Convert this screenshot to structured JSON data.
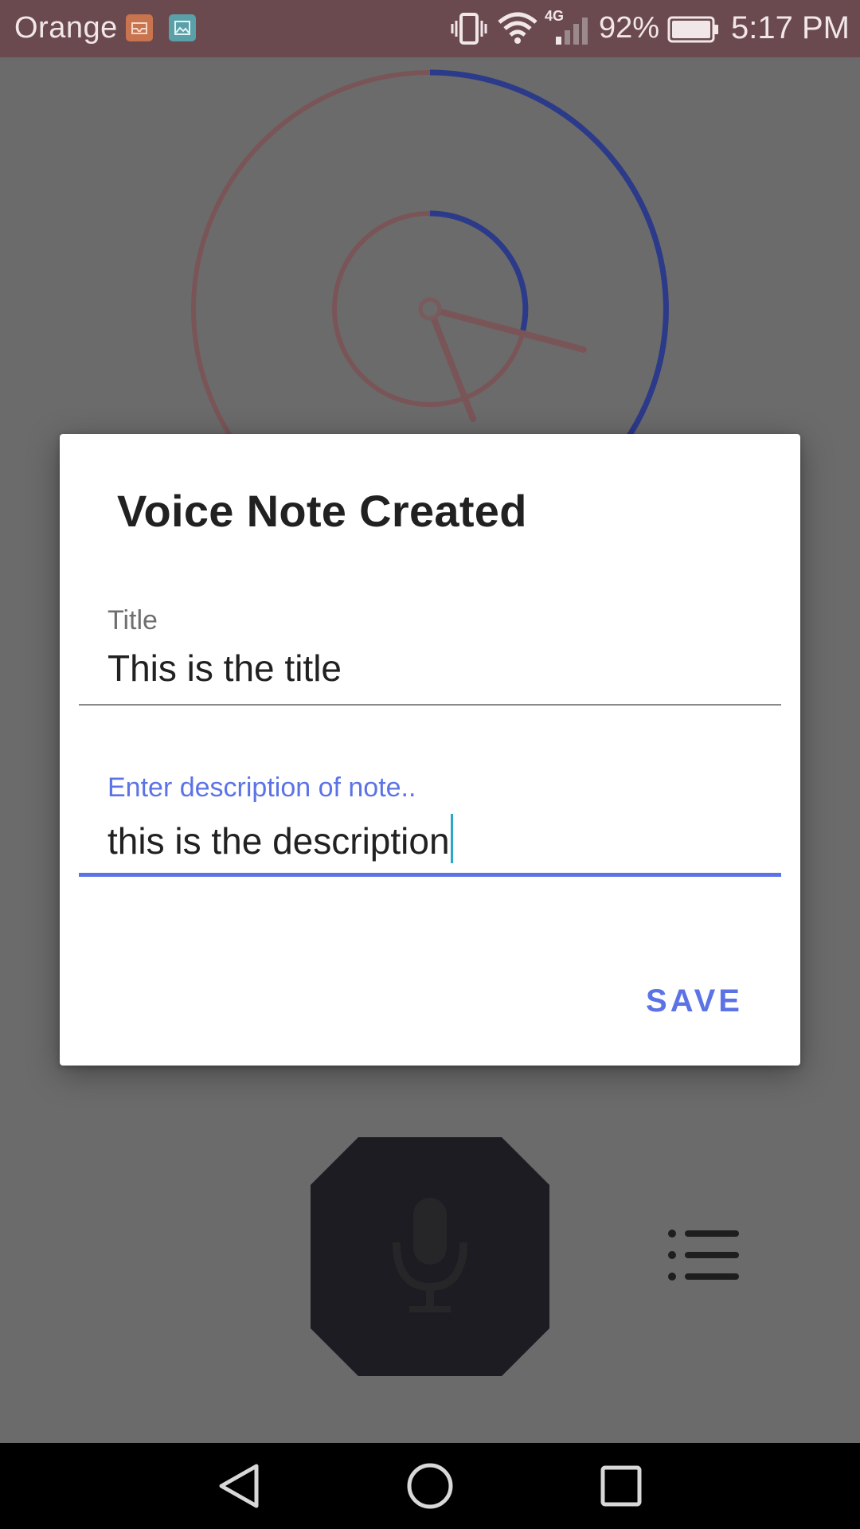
{
  "status_bar": {
    "carrier": "Orange",
    "battery_percent": "92%",
    "time": "5:17 PM",
    "network_type": "4G",
    "icons": [
      "inbox-notification-icon",
      "gallery-notification-icon",
      "vibrate-icon",
      "wifi-icon",
      "signal-icon",
      "battery-icon"
    ],
    "colors": {
      "background": "#6a4a4f",
      "inbox_icon": "#c8754f",
      "gallery_icon": "#5aa0a8"
    }
  },
  "recorder": {
    "progress_color": "#2c3a8a",
    "track_color": "#7a5558",
    "mic_icon": "microphone-icon",
    "list_icon": "list-icon"
  },
  "dialog": {
    "title": "Voice Note Created",
    "title_field": {
      "label": "Title",
      "value": "This is the title"
    },
    "description_field": {
      "label": "Enter description of note..",
      "value": "this is the description"
    },
    "save_label": "SAVE",
    "accent_color": "#5c73e6"
  },
  "nav_bar": {
    "icons": [
      "back-icon",
      "home-icon",
      "recents-icon"
    ]
  }
}
